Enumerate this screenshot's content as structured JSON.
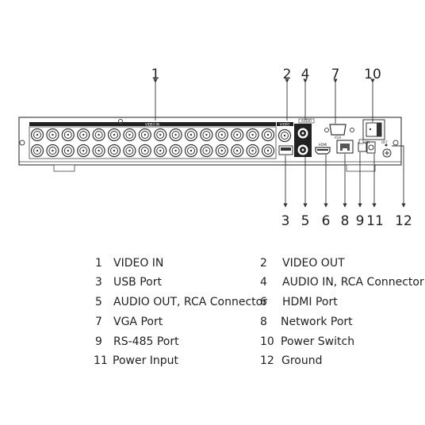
{
  "panel_labels": {
    "video_in": "VIDEO IN",
    "video_out": "VIDEO",
    "audio": "AUDIO",
    "hdmi": "HDMI",
    "vga": "VGA",
    "on": "ON",
    "off": "OFF"
  },
  "callouts_top": [
    "1",
    "2",
    "4",
    "7",
    "10"
  ],
  "callouts_bottom": [
    "3",
    "5",
    "6",
    "8",
    "9",
    "11",
    "12"
  ],
  "legend": [
    {
      "num": "1",
      "label": "VIDEO IN"
    },
    {
      "num": "2",
      "label": "VIDEO OUT"
    },
    {
      "num": "3",
      "label": "USB Port"
    },
    {
      "num": "4",
      "label": "AUDIO IN, RCA Connector"
    },
    {
      "num": "5",
      "label": "AUDIO OUT, RCA Connector"
    },
    {
      "num": "6",
      "label": "HDMI Port"
    },
    {
      "num": "7",
      "label": "VGA Port"
    },
    {
      "num": "8",
      "label": "Network Port"
    },
    {
      "num": "9",
      "label": "RS-485 Port"
    },
    {
      "num": "10",
      "label": "Power Switch"
    },
    {
      "num": "11",
      "label": "Power Input"
    },
    {
      "num": "12",
      "label": "Ground"
    }
  ]
}
